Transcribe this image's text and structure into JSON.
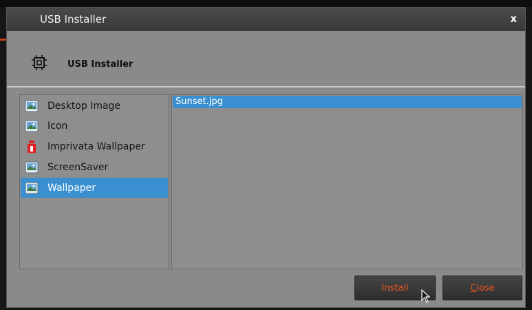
{
  "window": {
    "title": "USB Installer",
    "close_glyph": "x"
  },
  "header": {
    "title": "USB Installer",
    "icon": "chip-icon"
  },
  "categories": [
    {
      "label": "Desktop Image",
      "icon": "image-icon",
      "selected": false
    },
    {
      "label": "Icon",
      "icon": "image-icon",
      "selected": false
    },
    {
      "label": "Imprivata Wallpaper",
      "icon": "imprivata-icon",
      "selected": false
    },
    {
      "label": "ScreenSaver",
      "icon": "image-icon",
      "selected": false
    },
    {
      "label": "Wallpaper",
      "icon": "image-icon",
      "selected": true
    }
  ],
  "files": [
    {
      "label": "Sunset.jpg",
      "selected": true
    }
  ],
  "buttons": {
    "install_label": "Install",
    "close_label_mnemonic": "C",
    "close_label_rest": "lose"
  },
  "colors": {
    "selection": "#3a8fd0",
    "button_text": "#e6561c",
    "panel_bg": "#8e8e8e"
  }
}
